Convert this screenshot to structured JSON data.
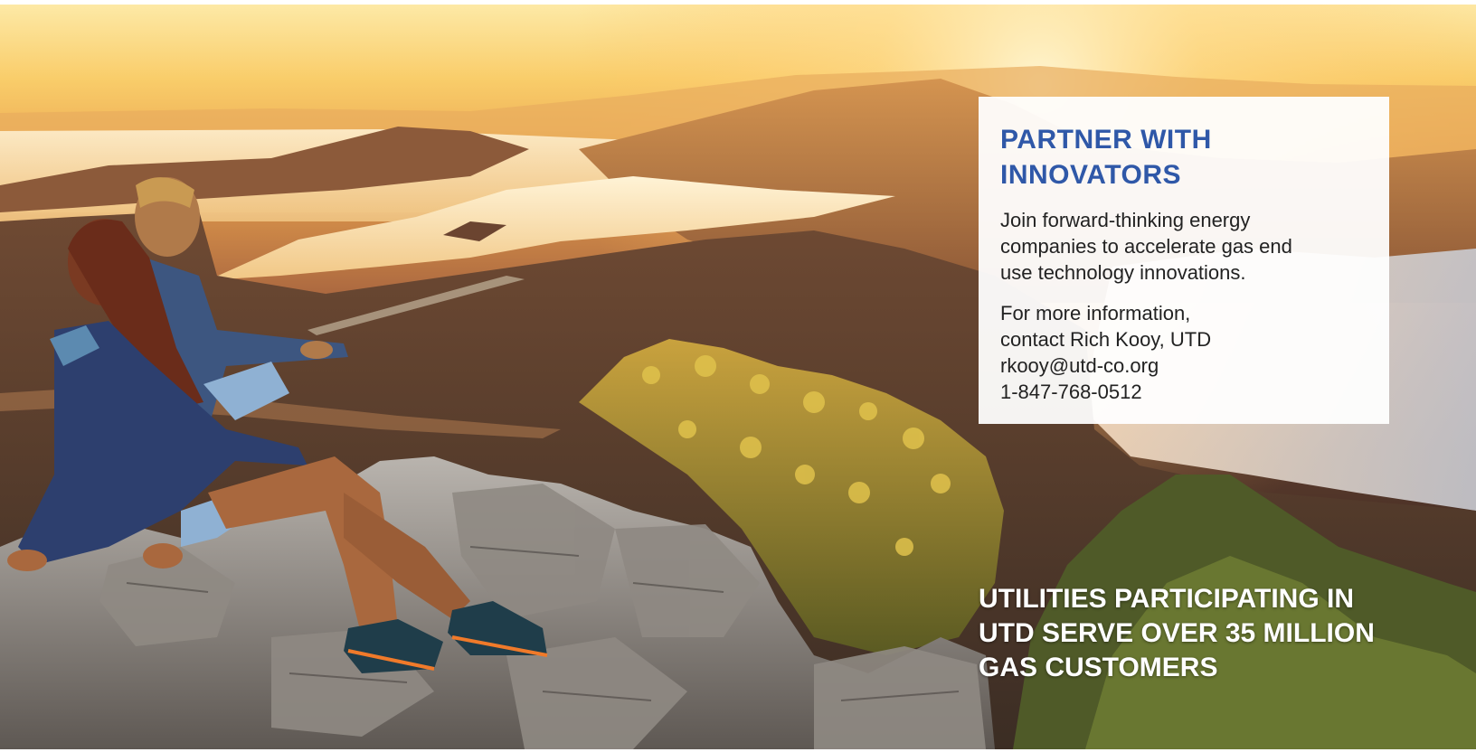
{
  "card": {
    "title": "PARTNER WITH INNOVATORS",
    "body": "Join forward-thinking energy companies to accelerate gas end use technology innovations.",
    "contact_lines": [
      "For more information,",
      "contact Rich Kooy, UTD",
      "rkooy@utd-co.org",
      "1-847-768-0512"
    ]
  },
  "stat_text": "UTILITIES PARTICIPATING IN UTD SERVE OVER 35 MILLION GAS CUSTOMERS",
  "colors": {
    "title_blue": "#2f58a8",
    "sky_top": "#fde9a6",
    "card_bg": "#ffffff"
  }
}
